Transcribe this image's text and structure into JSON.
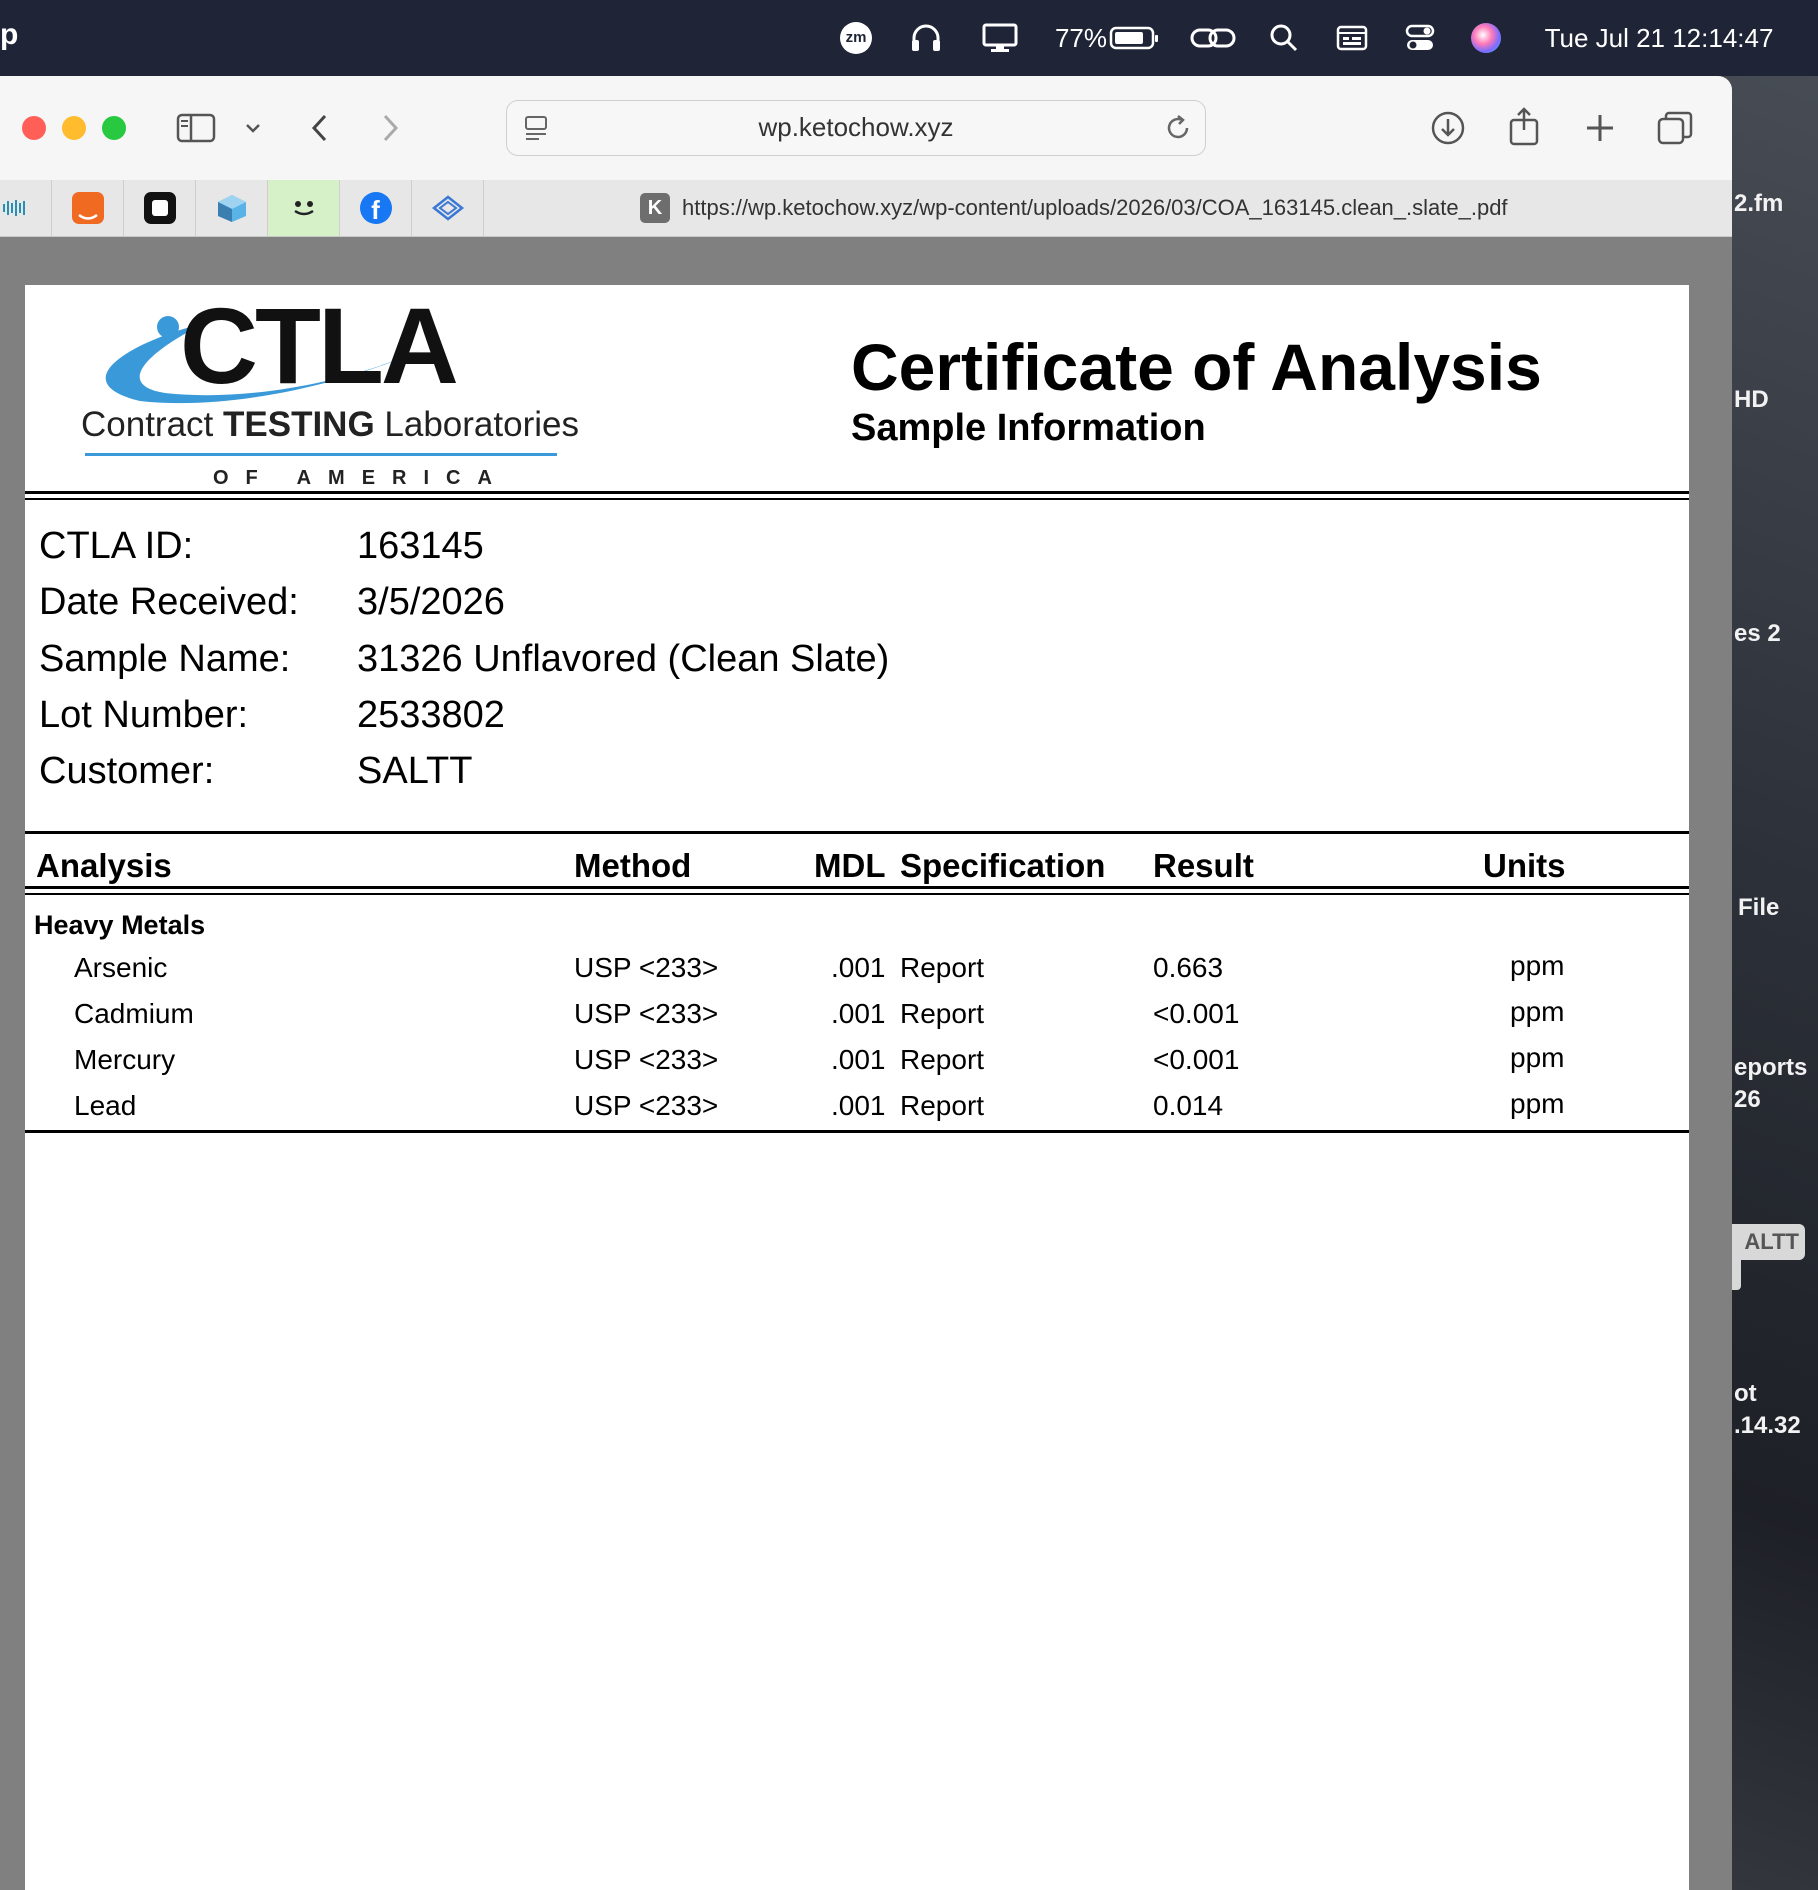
{
  "menubar": {
    "app_fragment": "p",
    "battery_percent": "77%",
    "zoom_label": "zm",
    "datetime": "Tue Jul 21  12:14:47"
  },
  "browser": {
    "url_display": "wp.ketochow.xyz",
    "full_url": "https://wp.ketochow.xyz/wp-content/uploads/2026/03/COA_163145.clean_.slate_.pdf",
    "favicon_badge": "K",
    "favorites": [
      "wave-icon",
      "amazon-icon",
      "notion-icon",
      "cube-icon",
      "face-icon",
      "facebook-icon",
      "diamond-icon"
    ]
  },
  "desktop": {
    "labels": [
      "2.fm",
      "HD",
      "es 2",
      "File",
      "eports",
      "26",
      "ot",
      ".14.32"
    ],
    "badge": "ALTT"
  },
  "document": {
    "logo": {
      "wordmark": "CTLA",
      "sub_prefix": "Contract ",
      "sub_bold": "TESTING",
      "sub_suffix": " Laboratories",
      "of_america": "OF AMERICA"
    },
    "title": "Certificate of Analysis",
    "subtitle": "Sample Information",
    "sample_info": [
      {
        "label": "CTLA ID:",
        "value": "163145"
      },
      {
        "label": "Date Received:",
        "value": "3/5/2026"
      },
      {
        "label": "Sample Name:",
        "value": "31326 Unflavored (Clean Slate)"
      },
      {
        "label": "Lot Number:",
        "value": "2533802"
      },
      {
        "label": "Customer:",
        "value": "SALTT"
      }
    ],
    "table": {
      "headers": {
        "analysis": "Analysis",
        "method": "Method",
        "mdl": "MDL",
        "specification": "Specification",
        "result": "Result",
        "units": "Units"
      },
      "section": "Heavy Metals",
      "rows": [
        {
          "analysis": "Arsenic",
          "method": "USP <233>",
          "mdl": ".001",
          "specification": "Report",
          "result": "0.663",
          "units": "ppm"
        },
        {
          "analysis": "Cadmium",
          "method": "USP <233>",
          "mdl": ".001",
          "specification": "Report",
          "result": "<0.001",
          "units": "ppm"
        },
        {
          "analysis": "Mercury",
          "method": "USP <233>",
          "mdl": ".001",
          "specification": "Report",
          "result": "<0.001",
          "units": "ppm"
        },
        {
          "analysis": "Lead",
          "method": "USP <233>",
          "mdl": ".001",
          "specification": "Report",
          "result": "0.014",
          "units": "ppm"
        }
      ]
    }
  },
  "colors": {
    "menubar": "#1f2536",
    "logo_blue": "#3a9ad9",
    "traffic_red": "#ff5f57",
    "traffic_yellow": "#febc2e",
    "traffic_green": "#28c840"
  }
}
